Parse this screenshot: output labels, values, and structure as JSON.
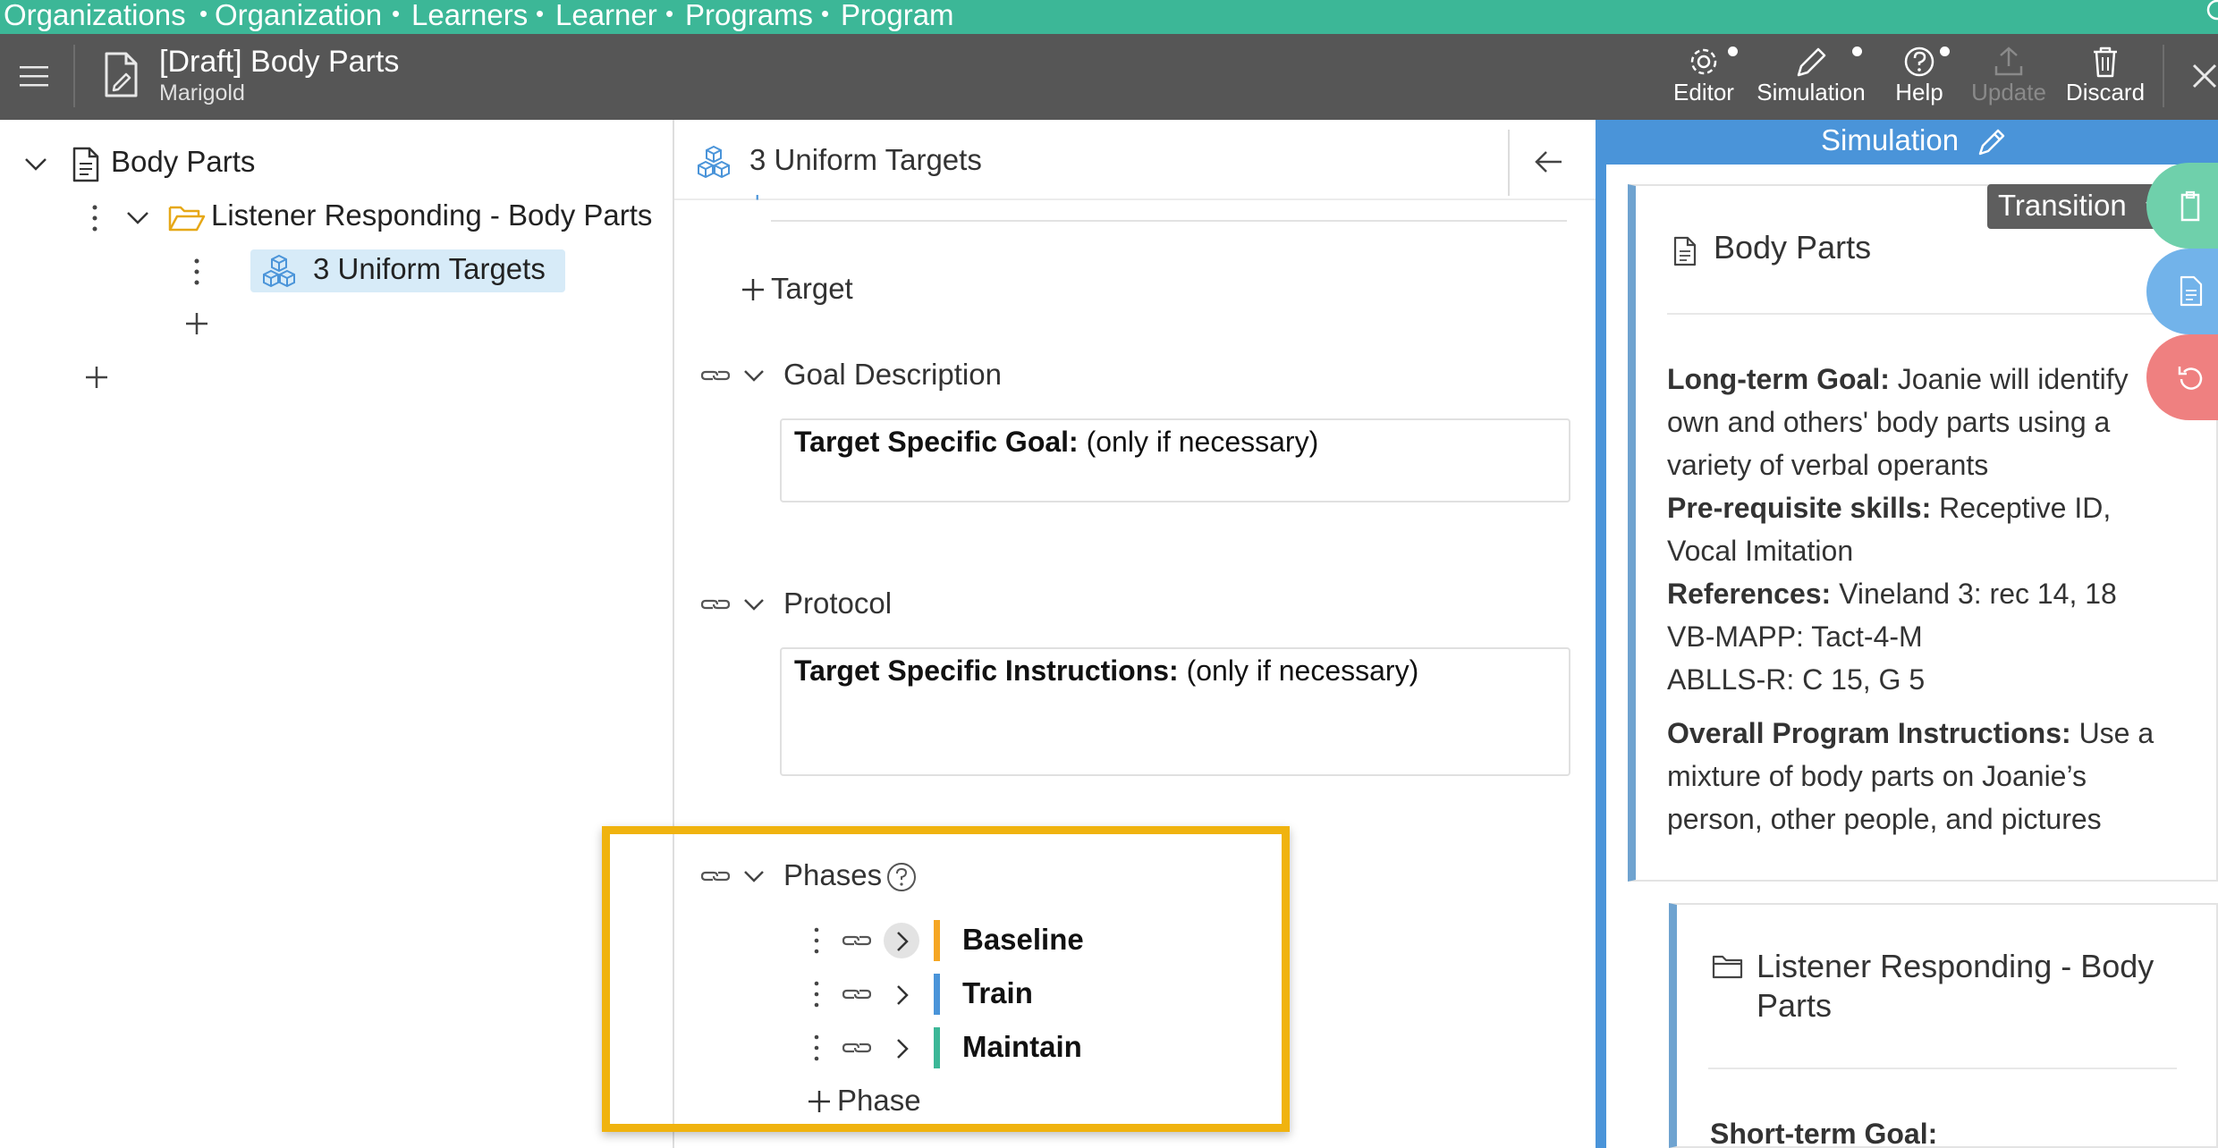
{
  "breadcrumb": [
    "Organizations",
    "Organization",
    "Learners",
    "Learner",
    "Programs",
    "Program"
  ],
  "breadcrumb_separator": "•",
  "header": {
    "doc_title": "[Draft] Body Parts",
    "doc_subtitle": "Marigold",
    "tools": [
      {
        "label": "Editor",
        "icon": "gear-icon",
        "has_dot": true,
        "enabled": true
      },
      {
        "label": "Simulation",
        "icon": "pencil-icon",
        "has_dot": true,
        "enabled": true
      },
      {
        "label": "Help",
        "icon": "help-circle-icon",
        "has_dot": true,
        "enabled": true
      },
      {
        "label": "Update",
        "icon": "upload-icon",
        "has_dot": false,
        "enabled": false
      },
      {
        "label": "Discard",
        "icon": "trash-icon",
        "has_dot": false,
        "enabled": true
      }
    ]
  },
  "tree": {
    "root": "Body Parts",
    "folder": "Listener Responding - Body Parts",
    "selected_item": "3 Uniform Targets"
  },
  "editor": {
    "title": "3 Uniform Targets",
    "add_target_label": "Target",
    "goal_section": {
      "label": "Goal Description",
      "field_bold": "Target Specific Goal:",
      "field_rest": " (only if necessary)"
    },
    "protocol_section": {
      "label": "Protocol",
      "field_bold": "Target Specific Instructions:",
      "field_rest": " (only if necessary)"
    },
    "phases_section": {
      "label": "Phases",
      "phases": [
        {
          "name": "Baseline",
          "color": "#f5a623"
        },
        {
          "name": "Train",
          "color": "#4a94d9"
        },
        {
          "name": "Maintain",
          "color": "#3cb797"
        }
      ],
      "add_phase_label": "Phase"
    }
  },
  "simulation": {
    "title": "Simulation",
    "transition_label": "Transition",
    "card1": {
      "title": "Body Parts",
      "long_term_goal_label": "Long-term Goal:",
      "long_term_goal_line1": " Joanie will identify",
      "long_term_goal_line2": "own and others' body parts using a",
      "long_term_goal_line3": "variety of verbal operants",
      "prereq_label": "Pre-requisite skills:",
      "prereq_line1": " Receptive ID,",
      "prereq_line2": "Vocal  Imitation",
      "references_label": "References:",
      "references_line1": " Vineland 3: rec 14, 18",
      "references_line2": "VB-MAPP: Tact-4-M",
      "references_line3": "ABLLS-R: C 15, G 5",
      "instructions_label": "Overall Program Instructions:",
      "instructions_line1": " Use a",
      "instructions_line2": "mixture of body parts on Joanie’s",
      "instructions_line3": "person, other people, and pictures"
    },
    "card2": {
      "title_line1": "Listener Responding - Body",
      "title_line2": "Parts",
      "short_term_goal_label": "Short-term Goal:"
    }
  },
  "colors": {
    "breadcrumb_bg": "#3cb797",
    "header_bg": "#565656",
    "simulation_accent": "#4a94d9",
    "highlight_border": "#f0b30f",
    "fab_green": "#6fd0ab",
    "fab_blue": "#72b3ea",
    "fab_red": "#ef8080"
  }
}
